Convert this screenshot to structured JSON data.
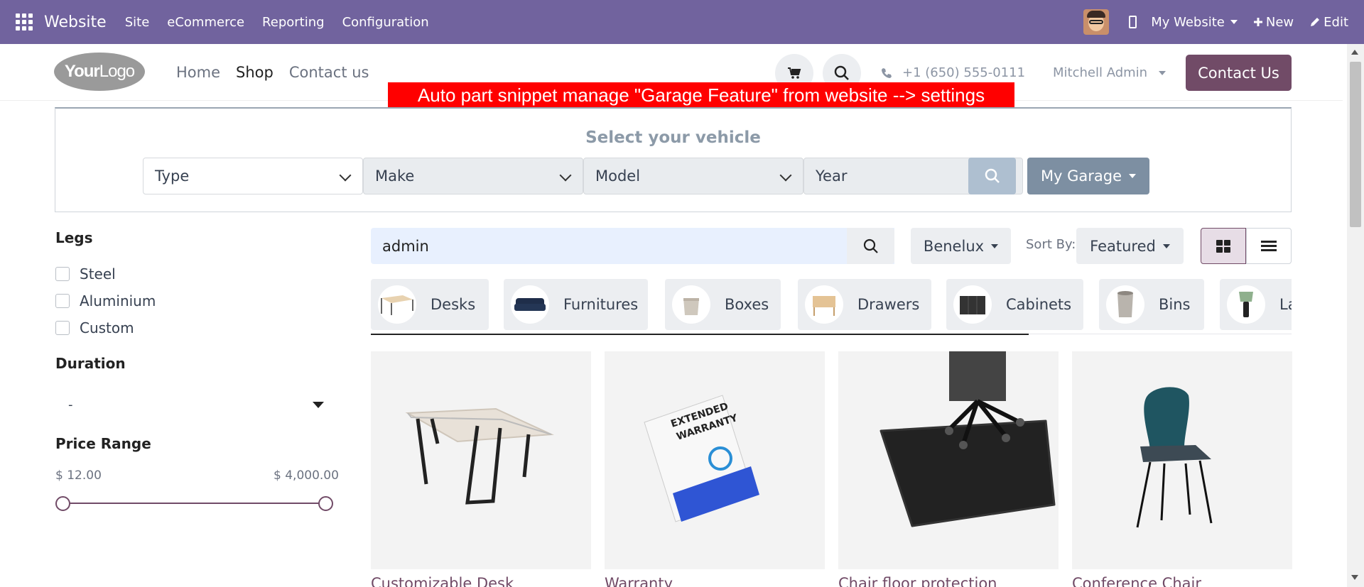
{
  "adminbar": {
    "brand": "Website",
    "menus": [
      "Site",
      "eCommerce",
      "Reporting",
      "Configuration"
    ],
    "my_website": "My Website",
    "new_label": "New",
    "edit_label": "Edit",
    "bg_color": "#71639e"
  },
  "header": {
    "logo_bold": "Your",
    "logo_thin": "Logo",
    "nav": [
      "Home",
      "Shop",
      "Contact us"
    ],
    "active_nav": "Shop",
    "phone": "+1 (650) 555-0111",
    "user": "Mitchell Admin",
    "contact_button": "Contact Us",
    "brand_color": "#714b67"
  },
  "banner": {
    "text": "Auto part snippet manage \"Garage Feature\" from website --> settings",
    "color": "#ff0000"
  },
  "vehicle": {
    "title": "Select your vehicle",
    "selects": [
      "Type",
      "Make",
      "Model",
      "Year"
    ],
    "my_garage": "My Garage"
  },
  "filters": {
    "legs_title": "Legs",
    "legs": [
      "Steel",
      "Aluminium",
      "Custom"
    ],
    "duration_title": "Duration",
    "duration_value": "-",
    "price_title": "Price Range",
    "price_min": "$ 12.00",
    "price_max": "$ 4,000.00"
  },
  "toolbar": {
    "search_value": "admin",
    "pricelist": "Benelux",
    "sort_label": "Sort By:",
    "sort_value": "Featured"
  },
  "categories": [
    "Desks",
    "Furnitures",
    "Boxes",
    "Drawers",
    "Cabinets",
    "Bins",
    "La"
  ],
  "products": [
    "Customizable Desk",
    "Warranty",
    "Chair floor protection",
    "Conference Chair"
  ],
  "warranty_box": {
    "line1": "EXTENDED",
    "line2": "WARRANTY"
  }
}
